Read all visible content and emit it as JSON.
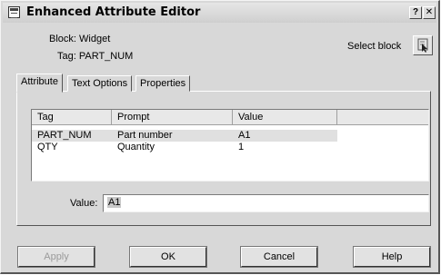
{
  "window": {
    "title": "Enhanced Attribute Editor",
    "help_glyph": "?",
    "close_glyph": "✕"
  },
  "info": {
    "block_line": "Block: Widget",
    "tag_line": "Tag: PART_NUM",
    "select_block_label": "Select block"
  },
  "tabs": [
    {
      "label": "Attribute",
      "active": true
    },
    {
      "label": "Text Options",
      "active": false
    },
    {
      "label": "Properties",
      "active": false
    }
  ],
  "table": {
    "columns": [
      "Tag",
      "Prompt",
      "Value"
    ],
    "rows": [
      {
        "tag": "PART_NUM",
        "prompt": "Part number",
        "value": "A1",
        "selected": true
      },
      {
        "tag": "QTY",
        "prompt": "Quantity",
        "value": "1",
        "selected": false
      }
    ]
  },
  "value_field": {
    "label": "Value:",
    "value": "A1"
  },
  "buttons": {
    "apply": "Apply",
    "ok": "OK",
    "cancel": "Cancel",
    "help": "Help"
  }
}
